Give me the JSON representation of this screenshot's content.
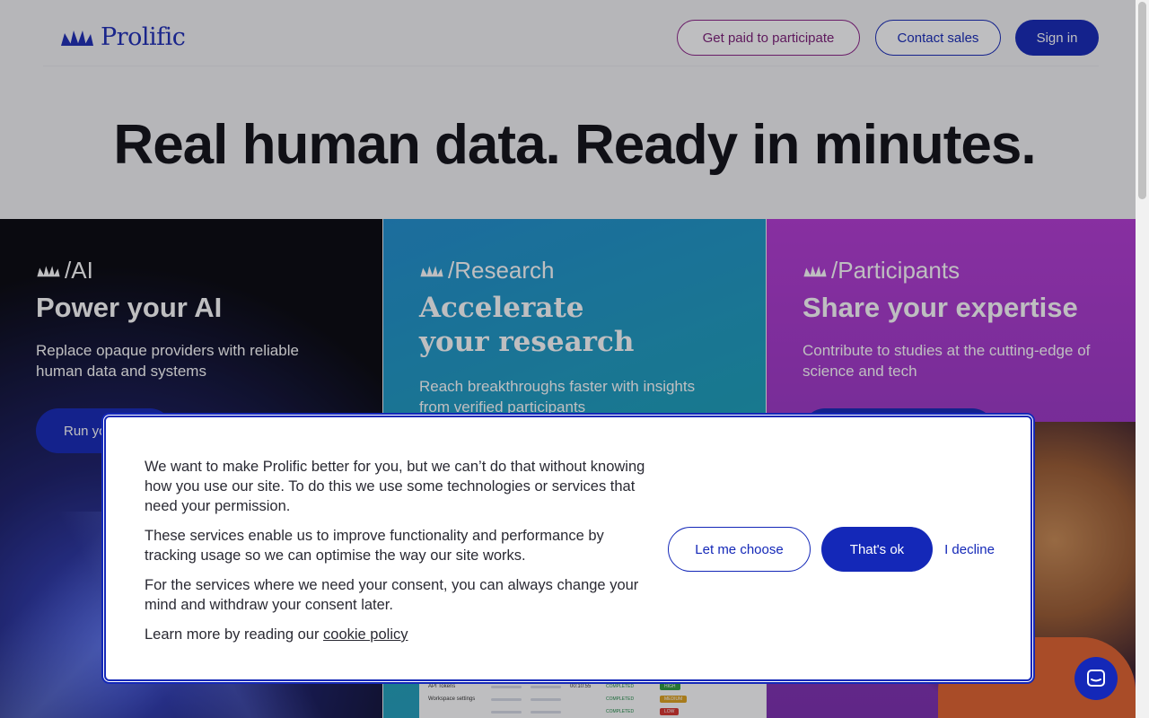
{
  "header": {
    "brand": "Prolific",
    "get_paid_label": "Get paid to participate",
    "contact_sales_label": "Contact sales",
    "sign_in_label": "Sign in"
  },
  "hero": {
    "title": "Real human data. Ready in minutes."
  },
  "cards": {
    "ai": {
      "tag": "/AI",
      "title": "Power your AI",
      "description": "Replace opaque providers with reliable human data and systems",
      "cta_label": "Run yo"
    },
    "research": {
      "tag": "/Research",
      "title_line1": "Accelerate",
      "title_line2": "your research",
      "description": "Reach breakthroughs faster with insights from verified participants",
      "dashboard": {
        "rows": [
          {
            "label": "API Tokens",
            "time": "00:10:55",
            "status": "COMPLETED",
            "badge": "HIGH",
            "badge_color": "#2c9a3c"
          },
          {
            "label": "Workspace settings",
            "time": "",
            "status": "COMPLETED",
            "badge": "MEDIUM",
            "badge_color": "#e0a21c"
          },
          {
            "label": "",
            "time": "",
            "status": "COMPLETED",
            "badge": "LOW",
            "badge_color": "#d9322b"
          }
        ]
      }
    },
    "participants": {
      "tag": "/Participants",
      "title": "Share your expertise",
      "description": "Contribute to studies at the cutting-edge of science and tech"
    }
  },
  "consent": {
    "para1": "We want to make Prolific better for you, but we can’t do that without knowing how you use our site. To do this we use some technologies or services that need your permission.",
    "para2": "These services enable us to improve functionality and performance by tracking usage so we can optimise the way our site works.",
    "para3": "For the services where we need your consent, you can always change your mind and withdraw your consent later.",
    "para4_prefix": "Learn more by reading our ",
    "cookie_policy_link": "cookie policy",
    "let_me_choose_label": "Let me choose",
    "thats_ok_label": "That's ok",
    "decline_label": "I decline"
  },
  "icons": {
    "logo": "prolific-fan-icon",
    "chat": "chat-bubble-icon"
  },
  "colors": {
    "brand_blue": "#1428b8",
    "participant_purple": "#7a1a75"
  }
}
